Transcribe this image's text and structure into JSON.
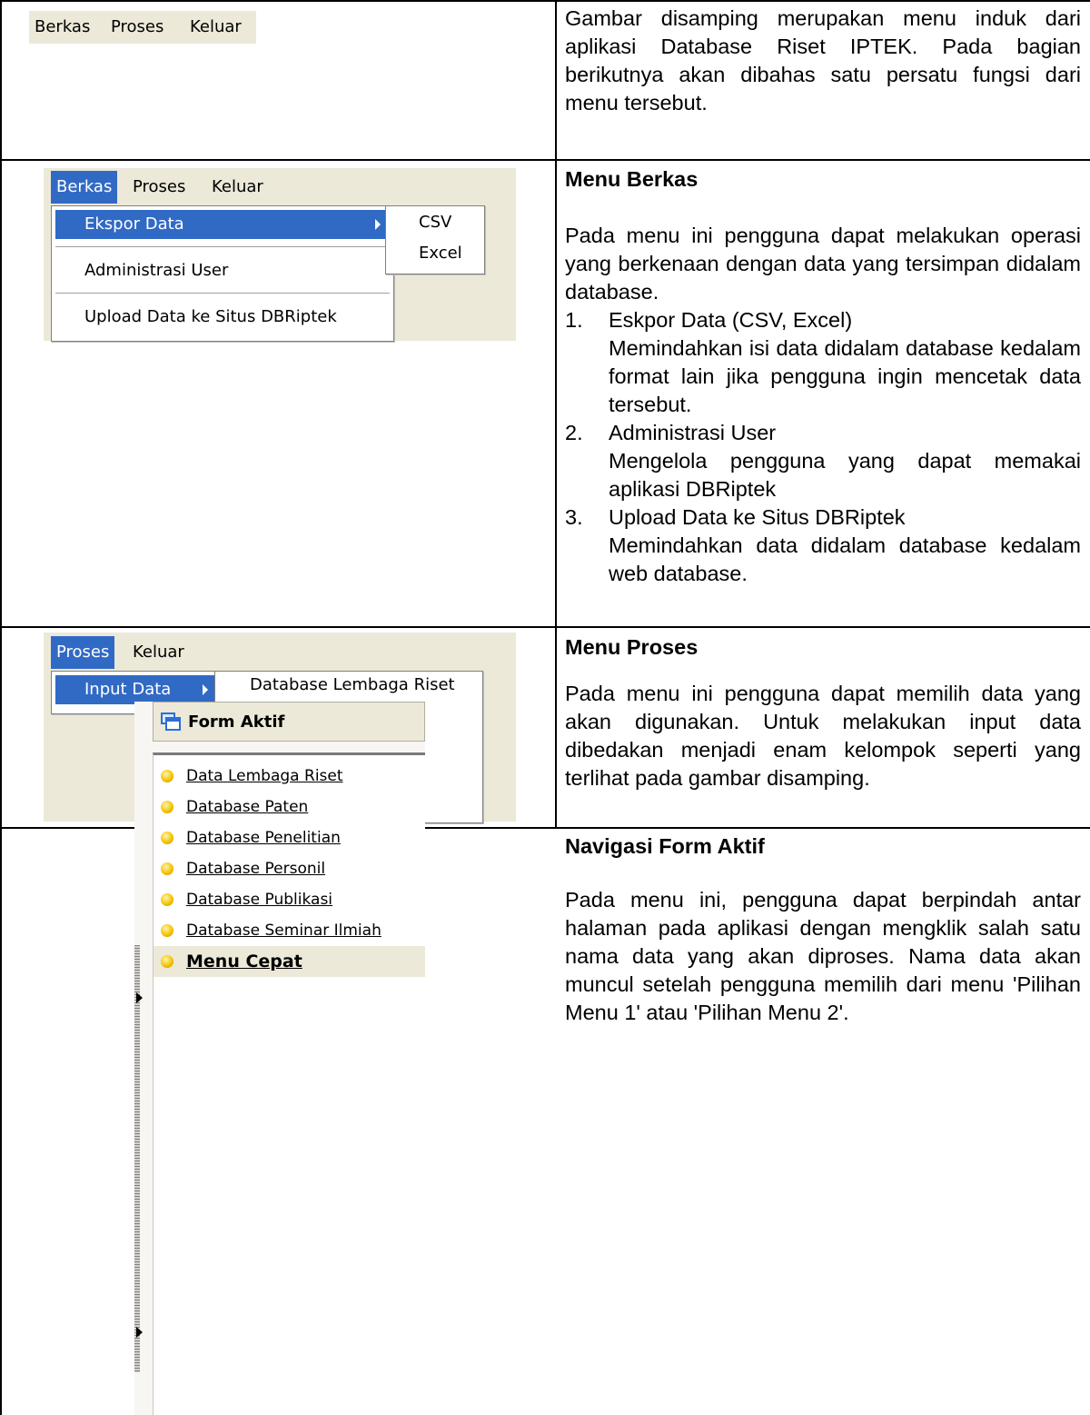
{
  "row1": {
    "menubar": [
      "Berkas",
      "Proses",
      "Keluar"
    ],
    "description": "Gambar disamping merupakan menu induk dari aplikasi Database Riset IPTEK. Pada bagian berikutnya akan dibahas satu persatu fungsi dari menu tersebut."
  },
  "row2": {
    "menubar": [
      "Berkas",
      "Proses",
      "Keluar"
    ],
    "menu_items": [
      "Ekspor Data",
      "Administrasi User",
      "Upload Data ke Situs DBRiptek"
    ],
    "submenu_items": [
      "CSV",
      "Excel"
    ],
    "heading": "Menu Berkas",
    "intro": "Pada menu ini pengguna dapat melakukan operasi yang berkenaan dengan data yang tersimpan didalam database.",
    "list": [
      {
        "num": "1.",
        "title": "Eskpor Data (CSV, Excel)",
        "desc": "Memindahkan isi data didalam database kedalam format lain jika pengguna ingin mencetak data tersebut."
      },
      {
        "num": "2.",
        "title": "Administrasi User",
        "desc": "Mengelola pengguna yang dapat memakai aplikasi DBRiptek"
      },
      {
        "num": "3.",
        "title": "Upload Data ke Situs DBRiptek",
        "desc": "Memindahkan data didalam database kedalam web database."
      }
    ]
  },
  "row3": {
    "menubar": [
      "Proses",
      "Keluar"
    ],
    "menu_items": [
      "Input Data"
    ],
    "submenu_items": [
      "Database Lembaga Riset",
      "Database Personil",
      "Database Penelitian",
      "Database Publikasi",
      "Database Seminar",
      "Database Paten"
    ],
    "heading": "Menu Proses",
    "intro": "Pada menu ini pengguna dapat memilih data yang akan digunakan. Untuk melakukan input data dibedakan menjadi enam kelompok seperti yang terlihat pada gambar disamping."
  },
  "row4": {
    "panel_title": "Form Aktif",
    "panel_items": [
      "Data Lembaga Riset",
      "Database Paten",
      "Database Penelitian",
      "Database Personil",
      "Database Publikasi",
      "Database Seminar Ilmiah",
      "Menu Cepat"
    ],
    "heading": "Navigasi Form Aktif",
    "intro": "Pada menu ini, pengguna dapat berpindah antar halaman pada aplikasi dengan mengklik salah satu nama data yang akan diproses. Nama data akan muncul setelah pengguna memilih dari menu 'Pilihan Menu 1' atau 'Pilihan Menu 2'."
  },
  "colors": {
    "menu_bg": "#ece9d8",
    "highlight": "#316ac5",
    "bullet": "#f5c400"
  }
}
